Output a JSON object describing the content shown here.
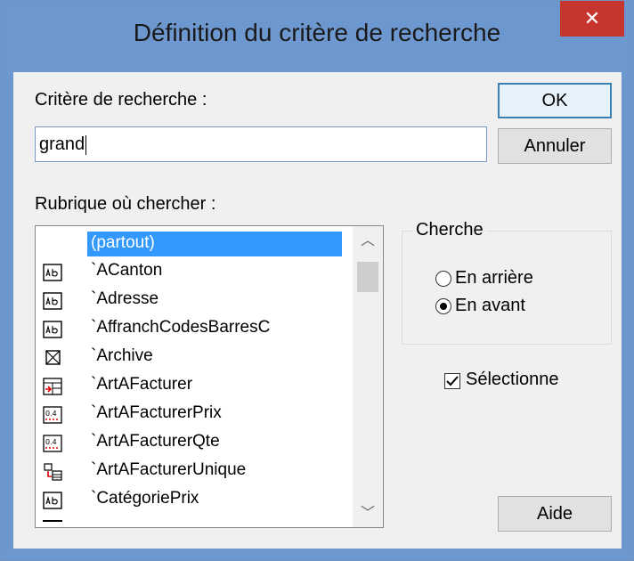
{
  "window": {
    "title": "Définition du critère de recherche",
    "close_glyph": "✕"
  },
  "criteria": {
    "label": "Critère de recherche :",
    "value": "grand"
  },
  "buttons": {
    "ok": "OK",
    "cancel": "Annuler",
    "help": "Aide"
  },
  "field_list": {
    "label": "Rubrique où chercher :",
    "items": [
      {
        "text": "(partout)",
        "icon": "none",
        "selected": true
      },
      {
        "text": "`ACanton",
        "icon": "text-field-icon"
      },
      {
        "text": "`Adresse",
        "icon": "text-field-icon"
      },
      {
        "text": "`AffranchCodesBarresC",
        "icon": "text-field-icon"
      },
      {
        "text": "`Archive",
        "icon": "checkbox-field-icon"
      },
      {
        "text": "`ArtAFacturer",
        "icon": "link-field-icon"
      },
      {
        "text": "`ArtAFacturerPrix",
        "icon": "number-field-icon"
      },
      {
        "text": "`ArtAFacturerQte",
        "icon": "number-field-icon"
      },
      {
        "text": "`ArtAFacturerUnique",
        "icon": "unique-link-icon"
      },
      {
        "text": "`CatégoriePrix",
        "icon": "text-field-icon"
      }
    ]
  },
  "direction": {
    "label": "Cherche",
    "options": [
      {
        "label": "En arrière",
        "checked": false
      },
      {
        "label": "En avant",
        "checked": true
      }
    ]
  },
  "select_option": {
    "label": "Sélectionne",
    "checked": true
  }
}
